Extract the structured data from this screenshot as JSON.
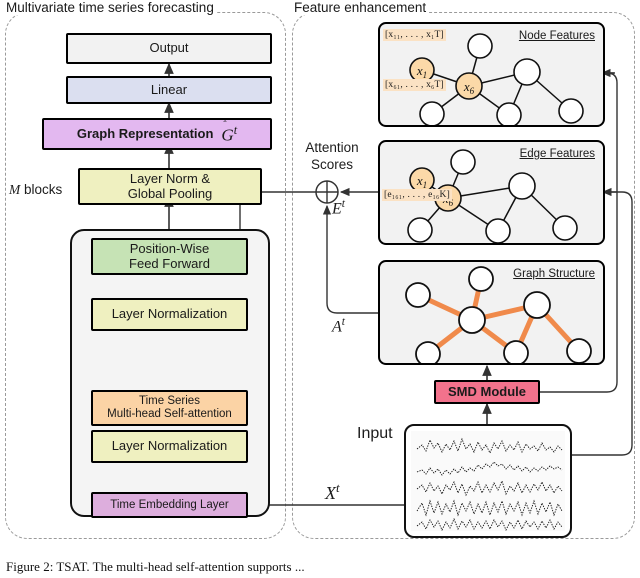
{
  "figure": {
    "caption": "Figure 2:  TSAT.  The multi-head self-attention supports ...",
    "regions": [
      {
        "id": "left",
        "title": "Multivariate time series forecasting"
      },
      {
        "id": "right",
        "title": "Feature enhancement"
      }
    ]
  },
  "pipeline": {
    "output": {
      "label": "Output",
      "color": "#f2f2f2"
    },
    "linear": {
      "label": "Linear",
      "color": "#dbdff0"
    },
    "graph_repr": {
      "label": "Graph Representation",
      "symbol": "G",
      "superscript": "t",
      "color": "#e3b8f0"
    },
    "layernorm_gp": {
      "label": "Layer Norm &\nGlobal Pooling",
      "line1": "Layer Norm &",
      "line2": "Global Pooling",
      "color": "#eff0c0"
    },
    "pwff": {
      "line1": "Position-Wise",
      "line2": "Feed Forward",
      "color": "#c6e3b5"
    },
    "layernorm_2": {
      "label": "Layer Normalization",
      "color": "#eff0c0"
    },
    "mhsa": {
      "line1": "Time Series",
      "line2": "Multi-head Self-attention",
      "color": "#fbd3a5"
    },
    "layernorm_1": {
      "label": "Layer Normalization",
      "color": "#eff0c0"
    },
    "time_embed": {
      "label": "Time Embedding Layer",
      "color": "#ddaedd"
    },
    "m_blocks": {
      "label_math": "M",
      "label_text": " blocks"
    }
  },
  "enhancement": {
    "attention_scores": {
      "line1": "Attention",
      "line2": "Scores",
      "operator": "+"
    },
    "edge_tensor_label": {
      "symbol": "E",
      "superscript": "t"
    },
    "adjacency_label": {
      "symbol": "A",
      "superscript": "t"
    },
    "input_label": {
      "symbol": "X",
      "superscript": "t"
    },
    "input_text": "Input",
    "smd": {
      "label": "SMD Module",
      "color": "#f2728c"
    },
    "panels": [
      {
        "id": "node-features",
        "title": "Node Features",
        "feature_labels": [
          "[x₁₁, . . . , x₁T]",
          "[x₆₁, . . . , x₆T]"
        ],
        "highlighted_nodes": [
          "x₁",
          "x₆"
        ],
        "edge_color": "#111111"
      },
      {
        "id": "edge-features",
        "title": "Edge Features",
        "feature_labels": [
          "[e₁₆₁, . . . , e₁₆K]"
        ],
        "highlighted_nodes": [
          "x₁",
          "x₆"
        ],
        "edge_color": "#111111"
      },
      {
        "id": "graph-structure",
        "title": "Graph Structure",
        "feature_labels": [],
        "highlighted_nodes": [],
        "edge_color": "#f08a4b"
      }
    ]
  },
  "colors": {
    "node_fill": "#fbd9a8",
    "plain_node_fill": "#ffffff",
    "panel_bg": "#f2f2f2",
    "orange_edge": "#f08a4b",
    "dash_border": "#9a9a9a"
  }
}
